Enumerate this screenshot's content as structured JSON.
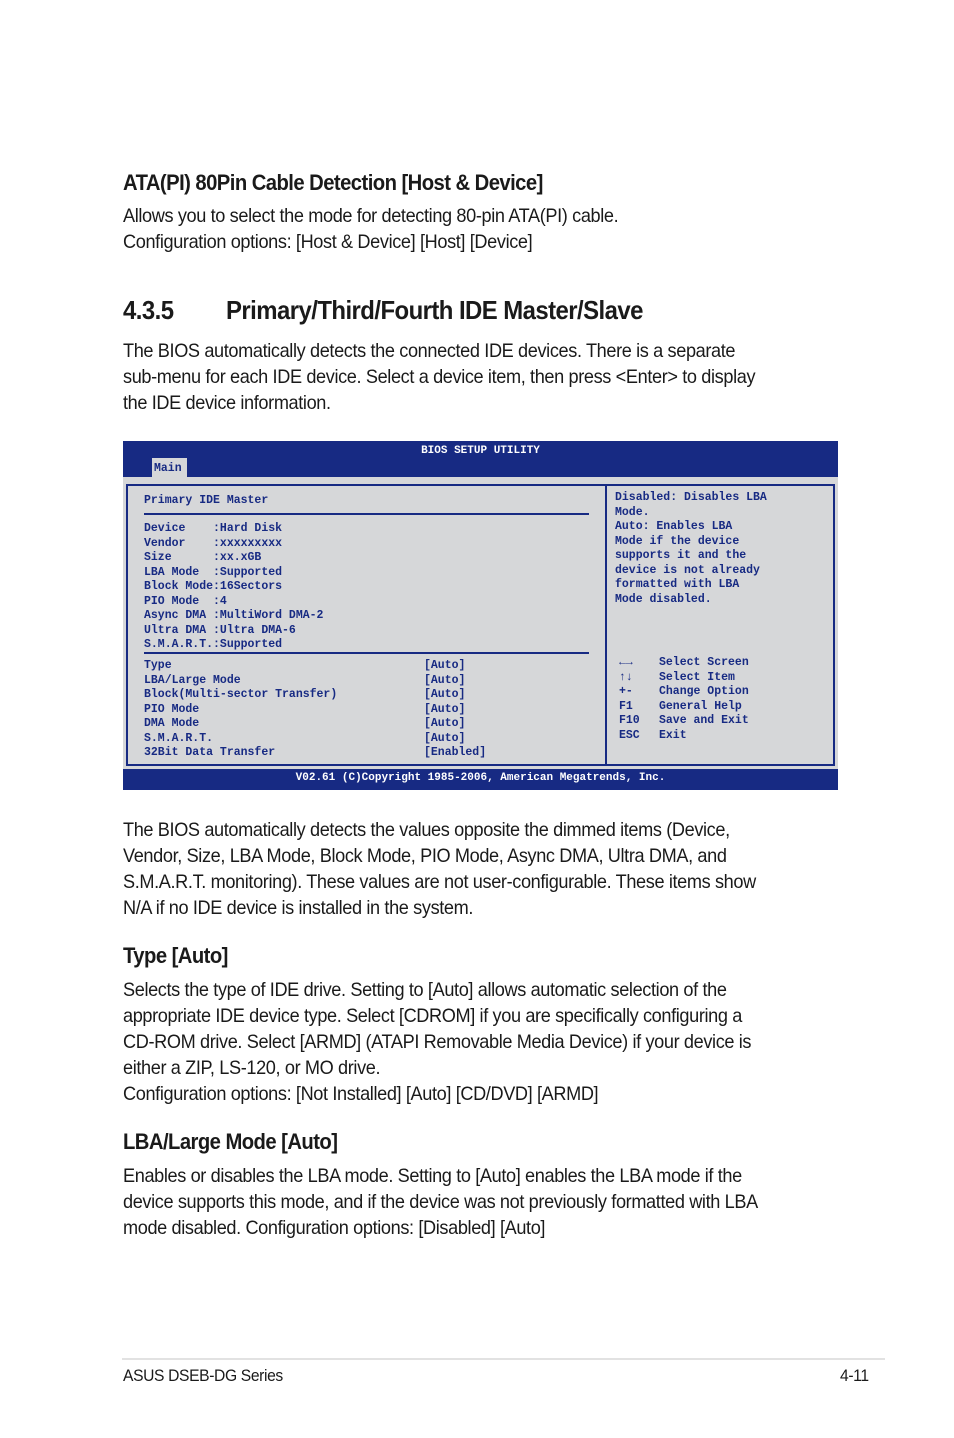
{
  "sections": {
    "cable_detection": {
      "heading": "ATA(PI) 80Pin Cable Detection [Host & Device]",
      "lines": [
        "Allows you to select the mode for detecting 80-pin ATA(PI) cable.",
        "Configuration options: [Host & Device] [Host] [Device]"
      ]
    },
    "ide_section": {
      "number": "4.3.5",
      "title": "Primary/Third/Fourth IDE Master/Slave",
      "lines": [
        "The BIOS automatically detects the connected IDE devices. There is a separate",
        "sub-menu for each IDE device. Select a device item, then press <Enter> to display",
        "the IDE device information."
      ]
    },
    "dimmed_note": {
      "lines": [
        "The BIOS automatically detects the values opposite the dimmed items (Device,",
        "Vendor, Size, LBA Mode, Block Mode, PIO Mode, Async DMA, Ultra DMA, and",
        "S.M.A.R.T. monitoring). These values are not user-configurable. These items show",
        "N/A if no IDE device is installed in the system."
      ]
    },
    "type_auto": {
      "heading": "Type [Auto]",
      "lines": [
        "Selects the type of IDE drive. Setting to [Auto] allows automatic selection of the",
        "appropriate IDE device type. Select [CDROM] if you are specifically configuring a",
        "CD-ROM drive. Select [ARMD] (ATAPI Removable Media Device) if your device is",
        "either a ZIP, LS-120, or MO drive.",
        "Configuration options: [Not Installed] [Auto] [CD/DVD] [ARMD]"
      ]
    },
    "lba_mode": {
      "heading": "LBA/Large Mode [Auto]",
      "lines": [
        "Enables or disables the LBA mode. Setting to [Auto] enables the LBA mode if the",
        "device supports this mode, and if the device was not previously formatted with LBA",
        "mode disabled. Configuration options: [Disabled] [Auto]"
      ]
    }
  },
  "bios": {
    "title": "BIOS SETUP UTILITY",
    "tab": "Main",
    "screen_title": "Primary IDE Master",
    "info": [
      {
        "label": "Device    ",
        "value": ":Hard Disk"
      },
      {
        "label": "Vendor    ",
        "value": ":xxxxxxxxx"
      },
      {
        "label": "Size      ",
        "value": ":xx.xGB"
      },
      {
        "label": "LBA Mode  ",
        "value": ":Supported"
      },
      {
        "label": "Block Mode",
        "value": ":16Sectors"
      },
      {
        "label": "PIO Mode  ",
        "value": ":4"
      },
      {
        "label": "Async DMA ",
        "value": ":MultiWord DMA-2"
      },
      {
        "label": "Ultra DMA ",
        "value": ":Ultra DMA-6"
      },
      {
        "label": "S.M.A.R.T.",
        "value": ":Supported"
      }
    ],
    "settings": [
      {
        "label": "Type",
        "value": "[Auto]"
      },
      {
        "label": "LBA/Large Mode",
        "value": "[Auto]"
      },
      {
        "label": "Block(Multi-sector Transfer)",
        "value": "[Auto]"
      },
      {
        "label": "PIO Mode",
        "value": "[Auto]"
      },
      {
        "label": "DMA Mode",
        "value": "[Auto]"
      },
      {
        "label": "S.M.A.R.T.",
        "value": "[Auto]"
      },
      {
        "label": "32Bit Data Transfer",
        "value": "[Enabled]"
      }
    ],
    "help_lines": [
      "Disabled: Disables LBA",
      "Mode.",
      "Auto: Enables LBA",
      "Mode if the device",
      "supports it and the",
      "device is not already",
      "formatted with LBA",
      "Mode disabled."
    ],
    "keys": [
      {
        "key": "←→",
        "action": "Select Screen"
      },
      {
        "key": "↑↓",
        "action": "Select Item"
      },
      {
        "key": "+-",
        "action": "Change Option"
      },
      {
        "key": "F1",
        "action": "General Help"
      },
      {
        "key": "F10",
        "action": "Save and Exit"
      },
      {
        "key": "ESC",
        "action": "Exit"
      }
    ],
    "footer": "V02.61 (C)Copyright 1985-2006, American Megatrends, Inc.",
    "colors": {
      "navy": "#172a83",
      "panel": "#d6d7d9"
    }
  },
  "footer": {
    "left": "ASUS DSEB-DG Series",
    "right": "4-11"
  }
}
